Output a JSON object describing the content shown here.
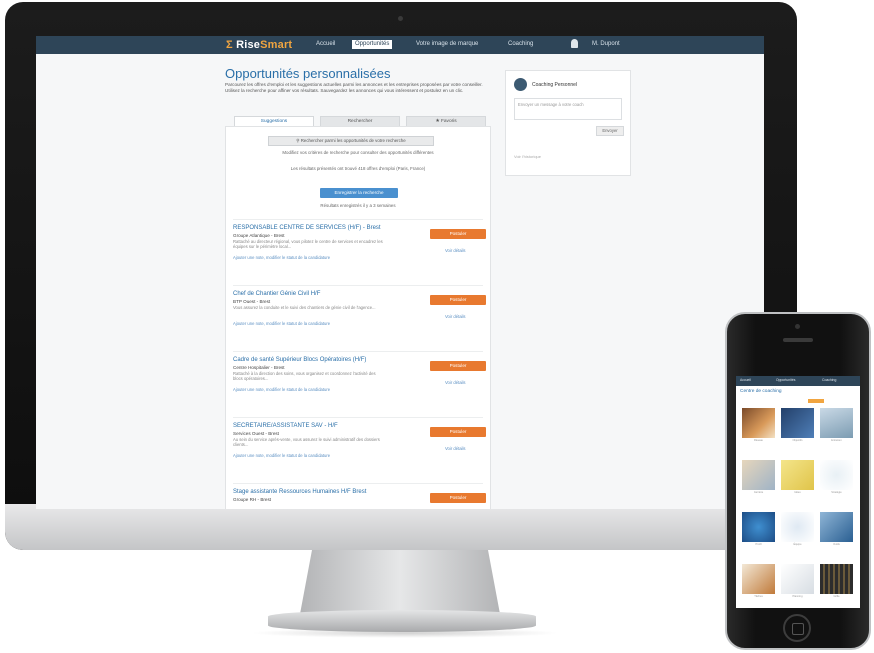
{
  "app": {
    "logo_prefix": "Rise",
    "logo_suffix": "Smart"
  },
  "nav": {
    "items": [
      "Accueil",
      "Opportunités",
      "Votre image de marque",
      "Coaching"
    ],
    "active": "Opportunités",
    "user": "M. Dupont"
  },
  "page": {
    "title": "Opportunités personnalisées",
    "intro": "Parcourez les offres d'emploi et les suggestions actuelles parmi les annonces et les entreprises proposées par votre conseiller. Utilisez la recherche pour affiner vos résultats. Sauvegardez les annonces qui vous intéressent et postulez en un clic."
  },
  "tabs": [
    "Suggestions",
    "Rechercher",
    "Favoris"
  ],
  "search_panel": {
    "button": "Rechercher parmi les opportunités de votre recherche",
    "hint": "Modifiez vos critères de recherche pour consulter des opportunités différentes",
    "results": "Les résultats présentés ont trouvé 418 offres d'emploi (Paris, France)",
    "cta": "Enregistrer la recherche",
    "cta_sub": "Résultats enregistrés il y a 3 semaines"
  },
  "jobs": [
    {
      "title": "RESPONSABLE CENTRE DE SERVICES (H/F) - Brest",
      "company": "Groupe Atlantique - Brest",
      "desc": "Rattaché au directeur régional, vous pilotez le centre de services et encadrez les équipes sur le périmètre local...",
      "link": "Ajouter une note, modifier le statut de la candidature",
      "apply": "Postuler",
      "more": "Voir détails"
    },
    {
      "title": "Chef de Chantier Génie Civil H/F",
      "company": "BTP Ouest - Brest",
      "desc": "Vous assurez la conduite et le suivi des chantiers de génie civil de l'agence...",
      "link": "Ajouter une note, modifier le statut de la candidature",
      "apply": "Postuler",
      "more": "Voir détails"
    },
    {
      "title": "Cadre de santé Supérieur Blocs Opératoires (H/F)",
      "company": "Centre Hospitalier - Brest",
      "desc": "Rattaché à la direction des soins, vous organisez et coordonnez l'activité des blocs opératoires...",
      "link": "Ajouter une note, modifier le statut de la candidature",
      "apply": "Postuler",
      "more": "Voir détails"
    },
    {
      "title": "SECRETAIRE/ASSISTANTE SAV - H/F",
      "company": "Services Ouest - Brest",
      "desc": "Au sein du service après-vente, vous assurez le suivi administratif des dossiers clients...",
      "link": "Ajouter une note, modifier le statut de la candidature",
      "apply": "Postuler",
      "more": "Voir détails"
    },
    {
      "title": "Stage assistante Ressources Humaines H/F Brest",
      "company": "Groupe RH - Brest",
      "desc": "",
      "link": "",
      "apply": "Postuler",
      "more": ""
    }
  ],
  "sidebar": {
    "title": "Coaching Personnel",
    "placeholder": "Envoyer un message à votre coach",
    "button": "Envoyer",
    "footer": "Voir l'historique"
  },
  "phone": {
    "nav": [
      "Accueil",
      "Opportunités",
      "Coaching"
    ],
    "title": "Centre de coaching",
    "tiles": [
      "Réseau",
      "Objectifs",
      "Entretien",
      "Carrière",
      "Idées",
      "Stratégie",
      "Profil",
      "Équipe",
      "Outils",
      "Tâches",
      "Planning",
      "Grille"
    ]
  },
  "colors": {
    "nav": "#2e4558",
    "accent": "#e8792f",
    "link": "#2a6fa8",
    "logo": "#f1a540"
  }
}
